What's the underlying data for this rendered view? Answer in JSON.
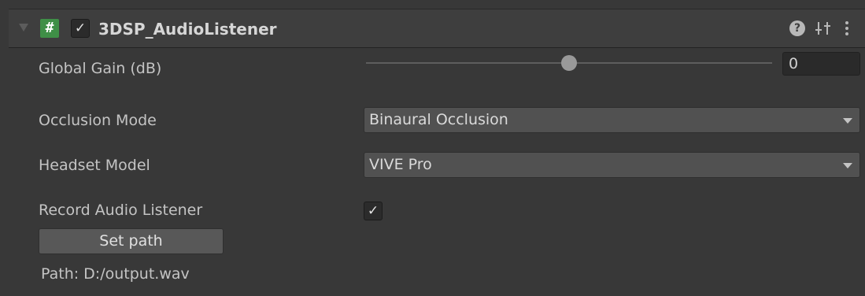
{
  "component": {
    "title": "3DSP_AudioListener",
    "enabled_check_glyph": "✓",
    "script_icon_glyph": "#",
    "icons": {
      "foldout": "foldout-triangle-icon",
      "script": "script-icon",
      "help": "help-icon",
      "presets": "presets-icon",
      "menu": "kebab-menu-icon"
    },
    "help_glyph": "?"
  },
  "global_gain": {
    "label": "Global Gain (dB)",
    "slider_fraction": 0.5,
    "value": "0"
  },
  "occlusion_mode": {
    "label": "Occlusion Mode",
    "selected": "Binaural Occlusion"
  },
  "headset_model": {
    "label": "Headset Model",
    "selected": "VIVE Pro"
  },
  "record_audio_listener": {
    "label": "Record Audio Listener",
    "checked_glyph": "✓"
  },
  "set_path_button": {
    "label": "Set path"
  },
  "path": {
    "text": "Path: D:/output.wav"
  },
  "colors": {
    "background": "#383838",
    "header": "#3e3e3e",
    "script_icon": "#3f8f47",
    "dropdown": "#515151",
    "field": "#2a2a2a"
  }
}
